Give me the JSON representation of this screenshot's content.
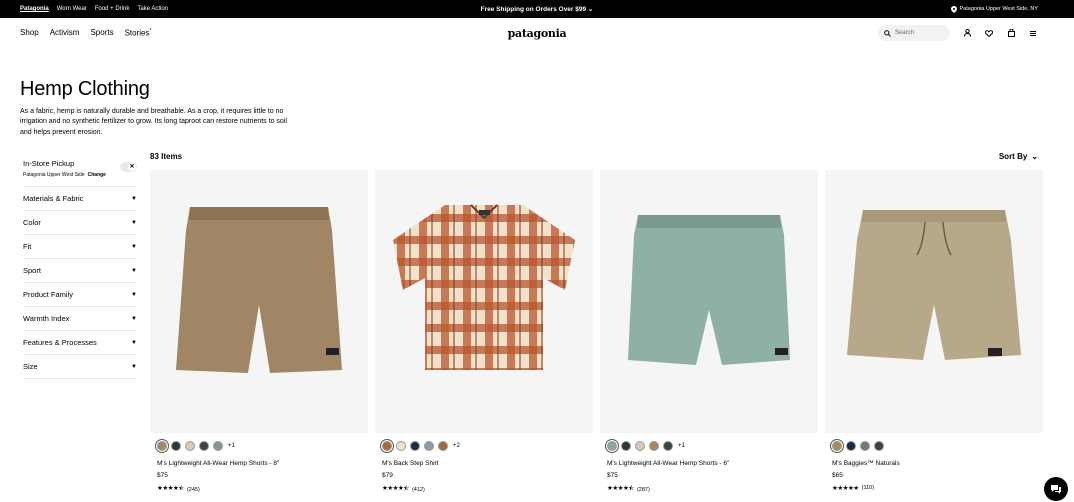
{
  "topbar": {
    "brands": [
      "Patagonia",
      "Worn Wear",
      "Food + Drink",
      "Take Action"
    ],
    "shipping": "Free Shipping on Orders Over $99",
    "store": "Patagonia Upper West Side, NY"
  },
  "nav": {
    "links": [
      "Shop",
      "Activism",
      "Sports",
      "Stories"
    ],
    "stories_mark": "*",
    "logo": "patagonia",
    "search_placeholder": "Search"
  },
  "page": {
    "title": "Hemp Clothing",
    "description": "As a fabric, hemp is naturally durable and breathable. As a crop, it requires little to no irrigation and no synthetic fertilizer to grow. Its long taproot can restore nutrients to soil and helps prevent erosion.",
    "item_count": "83 Items",
    "sort_label": "Sort By"
  },
  "pickup": {
    "title": "In-Store Pickup",
    "store": "Patagonia Upper West Side",
    "change": "Change",
    "toggle_glyph": "✕"
  },
  "filters": [
    "Materials & Fabric",
    "Color",
    "Fit",
    "Sport",
    "Product Family",
    "Warmth Index",
    "Features & Processes",
    "Size"
  ],
  "products": [
    {
      "name": "M's Lightweight All-Wear Hemp Shorts - 8\"",
      "price": "$75",
      "reviews": "(245)",
      "rating": 4.5,
      "more": "+1",
      "swatches": [
        "#a88a62",
        "#2f3633",
        "#d7c9b6",
        "#3d4540",
        "#7e9a98"
      ]
    },
    {
      "name": "M's Back Step Shirt",
      "price": "$79",
      "reviews": "(412)",
      "rating": 4.5,
      "more": "+2",
      "swatches": [
        "#a86a3e",
        "#f1e3c8",
        "#1e2a42",
        "#8e9ba4",
        "#9b6b45"
      ]
    },
    {
      "name": "M's Lightweight All-Wear Hemp Shorts - 6\"",
      "price": "$75",
      "reviews": "(287)",
      "rating": 4.5,
      "more": "+1",
      "swatches": [
        "#8aa89f",
        "#2f3633",
        "#d7c9b6",
        "#a88a62",
        "#3d4540"
      ]
    },
    {
      "name": "M's Baggies™ Naturals",
      "price": "$65",
      "reviews": "(110)",
      "rating": 5,
      "more": "",
      "swatches": [
        "#a68b62",
        "#1e2a42",
        "#6e7b79",
        "#3d4540"
      ]
    }
  ],
  "colors": {
    "topbar": "#000000",
    "image_bg": "#f5f5f5",
    "divider": "#e5e5e5"
  }
}
